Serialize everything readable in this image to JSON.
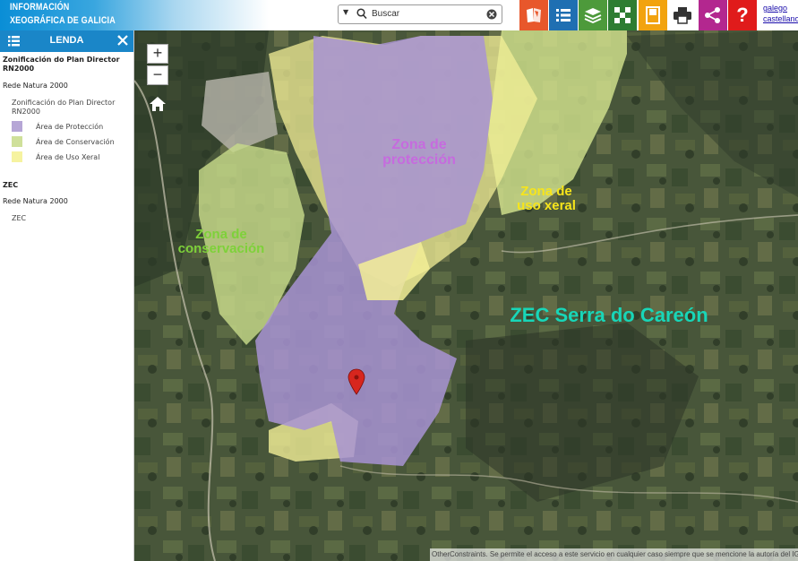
{
  "header": {
    "logo_line1": "INFORMACIÓN",
    "logo_line2": "XEOGRÁFICA DE GALICIA",
    "search_placeholder": "Buscar",
    "lang_gl": "galego",
    "lang_es": "castellano",
    "toolbar": [
      {
        "icon": "map-book-icon",
        "color": "#e8572b"
      },
      {
        "icon": "list-icon",
        "color": "#1f6fb2"
      },
      {
        "icon": "layers-icon",
        "color": "#4d9a3b"
      },
      {
        "icon": "grid-icon",
        "color": "#2e7d32"
      },
      {
        "icon": "bookmark-icon",
        "color": "#f2a30f"
      },
      {
        "icon": "print-icon",
        "color": "#ffffff"
      },
      {
        "icon": "share-icon",
        "color": "#b3278f"
      },
      {
        "icon": "help-icon",
        "color": "#e01b1b"
      }
    ]
  },
  "legend": {
    "title": "LENDA",
    "group1_title": "Zonificación do Plan Director RN2000",
    "group1_layer": "Rede Natura 2000",
    "group1_sublayer": "Zonificación do Plan Director RN2000",
    "items": [
      {
        "label": "Área de Protección",
        "color": "#b6a6d6"
      },
      {
        "label": "Área de Conservación",
        "color": "#cfe09a"
      },
      {
        "label": "Área de Uso Xeral",
        "color": "#f6f3a0"
      }
    ],
    "group2_title": "ZEC",
    "group2_layer": "Rede Natura 2000",
    "group2_sublayer": "ZEC"
  },
  "map": {
    "zoom_in": "+",
    "zoom_out": "−",
    "label_proteccion": "Zona de\nprotección",
    "label_conservacion": "Zona de\nconservación",
    "label_uso": "Zona de\nuso xeral",
    "label_zec": "ZEC Serra do Careón",
    "attribution": "OtherConstraints. Se permite el acceso a este servicio en cualquier caso siempre que se mencione la autoría del IGN como propietario"
  }
}
